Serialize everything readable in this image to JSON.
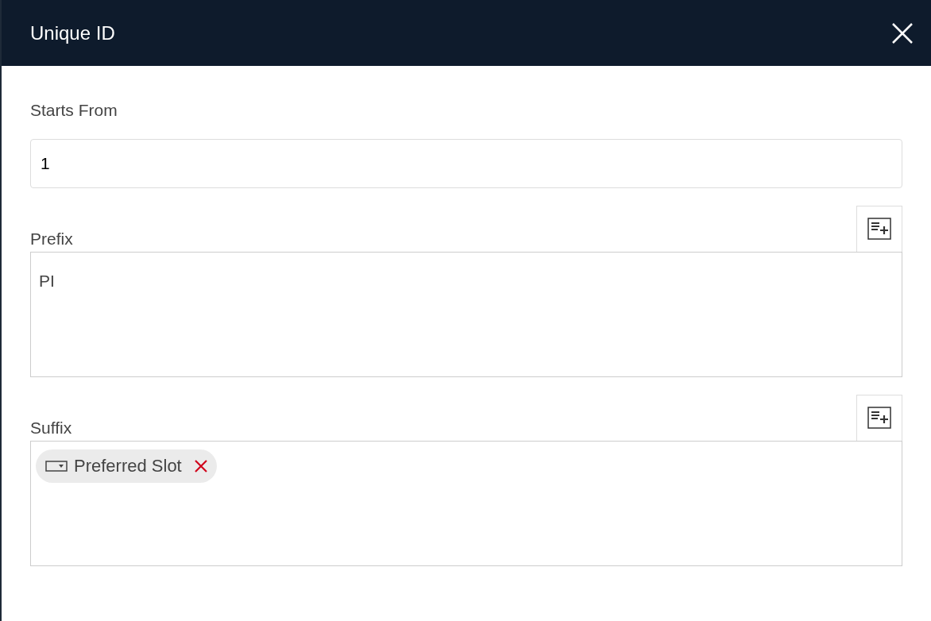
{
  "dialog": {
    "title": "Unique ID"
  },
  "fields": [
    {
      "kind": "input",
      "label": "Starts From",
      "value": "1"
    },
    {
      "kind": "editor",
      "label": "Prefix",
      "value": "PI"
    },
    {
      "kind": "editor",
      "label": "Suffix",
      "tokens": [
        {
          "label": "Preferred Slot"
        }
      ]
    }
  ]
}
